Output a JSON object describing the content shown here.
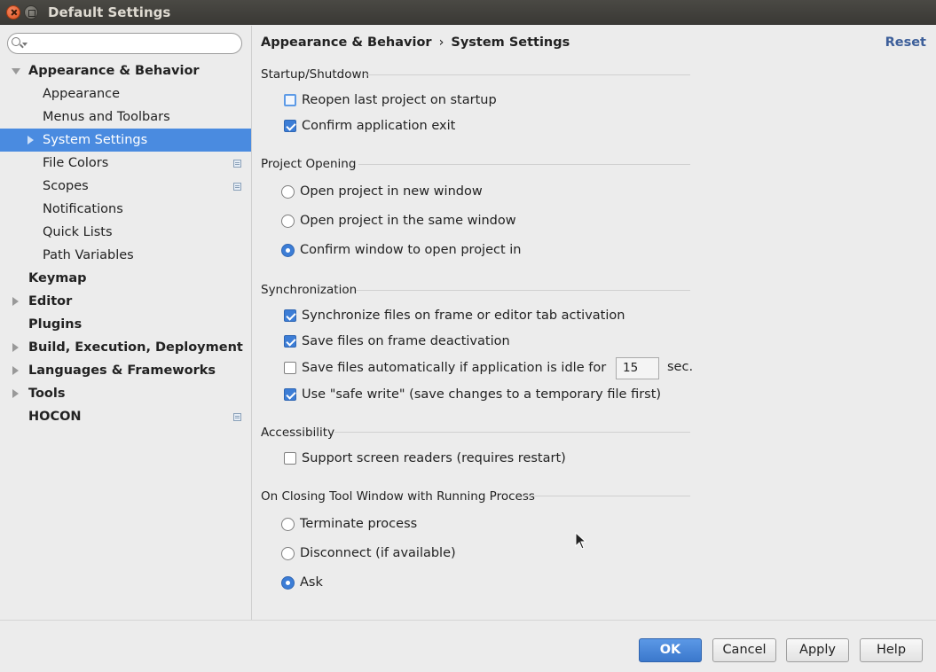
{
  "window": {
    "title": "Default Settings"
  },
  "sidebar": {
    "search_placeholder": "",
    "items": [
      {
        "label": "Appearance & Behavior"
      },
      {
        "label": "Appearance"
      },
      {
        "label": "Menus and Toolbars"
      },
      {
        "label": "System Settings"
      },
      {
        "label": "File Colors"
      },
      {
        "label": "Scopes"
      },
      {
        "label": "Notifications"
      },
      {
        "label": "Quick Lists"
      },
      {
        "label": "Path Variables"
      },
      {
        "label": "Keymap"
      },
      {
        "label": "Editor"
      },
      {
        "label": "Plugins"
      },
      {
        "label": "Build, Execution, Deployment"
      },
      {
        "label": "Languages & Frameworks"
      },
      {
        "label": "Tools"
      },
      {
        "label": "HOCON"
      }
    ]
  },
  "header": {
    "crumb_parent": "Appearance & Behavior",
    "crumb_sep": "›",
    "crumb_current": "System Settings",
    "reset": "Reset"
  },
  "groups": {
    "startup": {
      "title": "Startup/Shutdown",
      "reopen": {
        "label": "Reopen last project on startup",
        "checked": false
      },
      "confirm_exit": {
        "label": "Confirm application exit",
        "checked": true
      }
    },
    "project_opening": {
      "title": "Project Opening",
      "new_window": "Open project in new window",
      "same_window": "Open project in the same window",
      "confirm_window": "Confirm window to open project in",
      "selected": "confirm_window"
    },
    "sync": {
      "title": "Synchronization",
      "sync_files": "Synchronize files on frame or editor tab activation",
      "save_deactivation": "Save files on frame deactivation",
      "save_idle": "Save files automatically if application is idle for",
      "idle_value": "15",
      "idle_unit": "sec.",
      "safe_write": "Use \"safe write\" (save changes to a temporary file first)"
    },
    "accessibility": {
      "title": "Accessibility",
      "screen_readers": "Support screen readers (requires restart)"
    },
    "closing": {
      "title": "On Closing Tool Window with Running Process",
      "terminate": "Terminate process",
      "disconnect": "Disconnect (if available)",
      "ask": "Ask",
      "selected": "ask"
    }
  },
  "buttons": {
    "ok": "OK",
    "cancel": "Cancel",
    "apply": "Apply",
    "help": "Help"
  },
  "colors": {
    "accent": "#4a8be0",
    "link": "#3d5f9a"
  }
}
